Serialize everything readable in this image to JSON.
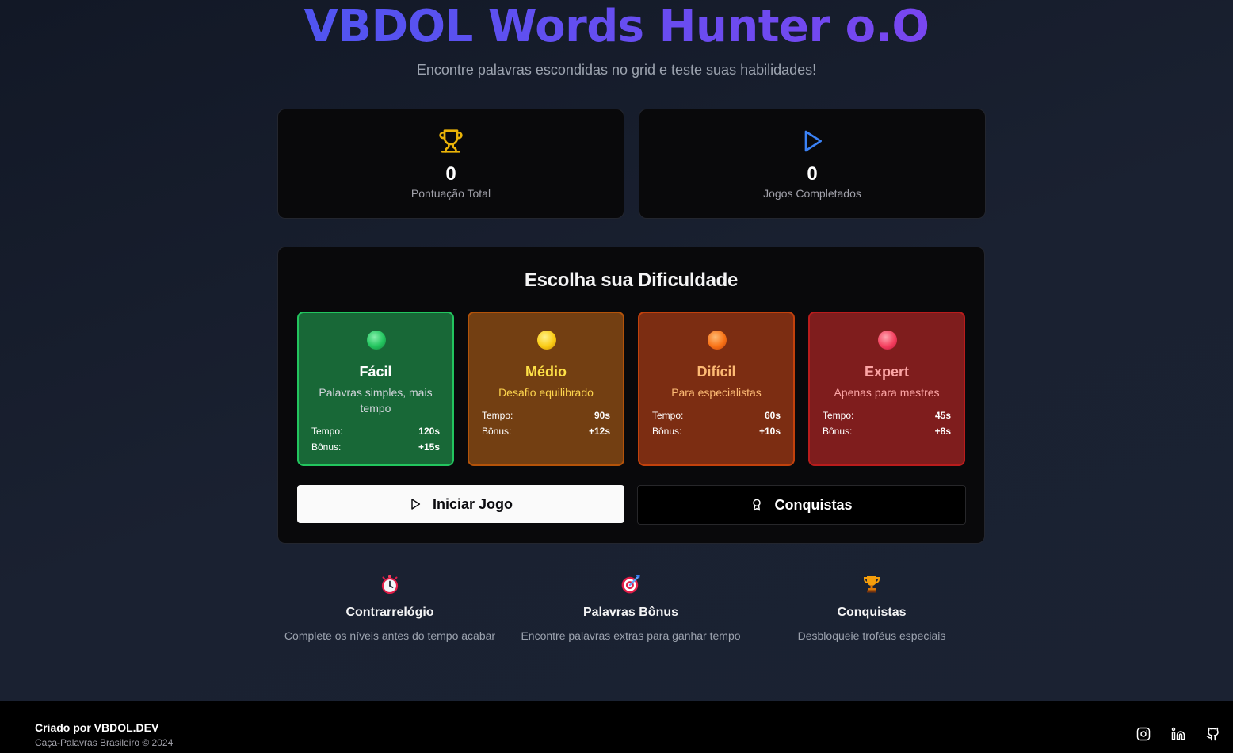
{
  "header": {
    "title": "VBDOL Words Hunter o.O",
    "subtitle": "Encontre palavras escondidas no grid e teste suas habilidades!"
  },
  "stats": [
    {
      "icon": "trophy-icon",
      "value": "0",
      "label": "Pontuação Total",
      "color": "#eab308"
    },
    {
      "icon": "play-icon",
      "value": "0",
      "label": "Jogos Completados",
      "color": "#3b82f6"
    }
  ],
  "difficulty": {
    "title": "Escolha sua Dificuldade",
    "levels": [
      {
        "name": "Fácil",
        "description": "Palavras simples, mais tempo",
        "time_label": "Tempo:",
        "time": "120s",
        "bonus_label": "Bônus:",
        "bonus": "+15s",
        "bg": "#186837",
        "border": "#22c55e",
        "name_color": "#ffffff",
        "desc_color": "#d1d5db"
      },
      {
        "name": "Médio",
        "description": "Desafio equilibrado",
        "time_label": "Tempo:",
        "time": "90s",
        "bonus_label": "Bônus:",
        "bonus": "+12s",
        "bg": "#733f12",
        "border": "#b45309",
        "name_color": "#fde047",
        "desc_color": "#fcd34d"
      },
      {
        "name": "Difícil",
        "description": "Para especialistas",
        "time_label": "Tempo:",
        "time": "60s",
        "bonus_label": "Bônus:",
        "bonus": "+10s",
        "bg": "#7c2d12",
        "border": "#c2410c",
        "name_color": "#fdba74",
        "desc_color": "#fdba74"
      },
      {
        "name": "Expert",
        "description": "Apenas para mestres",
        "time_label": "Tempo:",
        "time": "45s",
        "bonus_label": "Bônus:",
        "bonus": "+8s",
        "bg": "#7f1d1d",
        "border": "#b91c1c",
        "name_color": "#fca5a5",
        "desc_color": "#fca5a5"
      }
    ]
  },
  "actions": {
    "start_label": "Iniciar Jogo",
    "achievements_label": "Conquistas"
  },
  "features": [
    {
      "icon": "stopwatch-icon",
      "title": "Contrarrelógio",
      "description": "Complete os níveis antes do tempo acabar"
    },
    {
      "icon": "target-icon",
      "title": "Palavras Bônus",
      "description": "Encontre palavras extras para ganhar tempo"
    },
    {
      "icon": "trophy-icon",
      "title": "Conquistas",
      "description": "Desbloqueie troféus especiais"
    }
  ],
  "footer": {
    "created_by": "Criado por VBDOL.DEV",
    "copyright": "Caça-Palavras Brasileiro © 2024",
    "social": [
      "instagram-icon",
      "linkedin-icon",
      "github-icon"
    ]
  }
}
